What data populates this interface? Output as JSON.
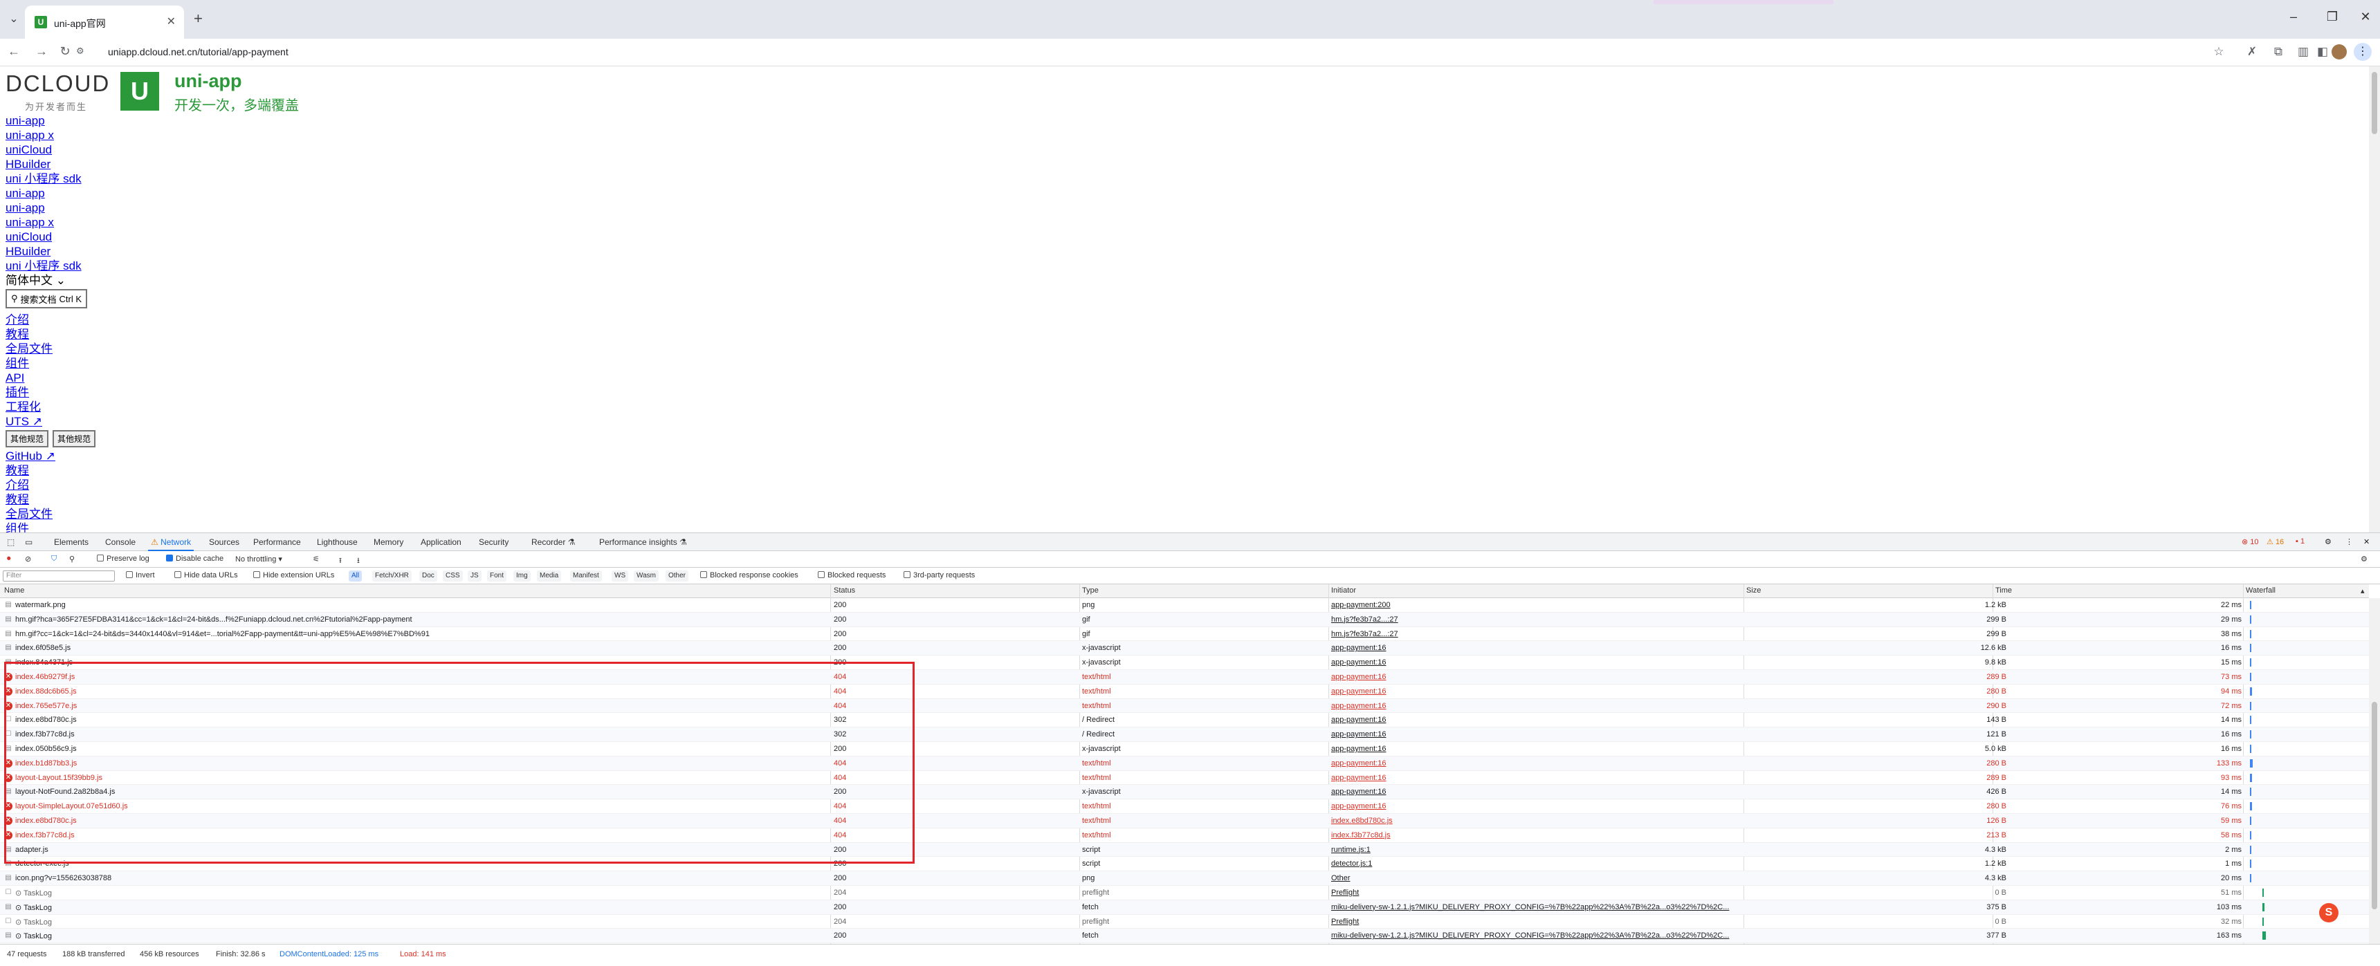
{
  "browser": {
    "tab_title": "uni-app官网",
    "tab_favicon": "U",
    "url": "uniapp.dcloud.net.cn/tutorial/app-payment",
    "window_buttons": [
      "–",
      "❐",
      "✕"
    ],
    "new_tab": "+"
  },
  "page": {
    "dcloud_logo": "DCLOUD",
    "dcloud_tagline": "为开发者而生",
    "uni_logo_letter": "U",
    "uni_name": "uni-app",
    "uni_slogan": "开发一次，多端覆盖",
    "links": [
      "uni-app",
      "uni-app x",
      "uniCloud",
      "HBuilder",
      "uni 小程序 sdk",
      "uni-app",
      "uni-app",
      "uni-app x",
      "uniCloud",
      "HBuilder",
      "uni 小程序 sdk"
    ],
    "language": "简体中文",
    "search_label": "搜索文档",
    "search_shortcut": "Ctrl K",
    "nav_links": [
      "介绍",
      "教程",
      "全局文件",
      "组件",
      "API",
      "插件",
      "工程化",
      "UTS"
    ],
    "spec_buttons": [
      "其他规范",
      "其他规范"
    ],
    "nav_links_2": [
      "GitHub",
      "教程",
      "介绍",
      "教程",
      "全局文件",
      "组件"
    ]
  },
  "devtools": {
    "tabs": [
      "Elements",
      "Console",
      "Network",
      "Sources",
      "Performance",
      "Lighthouse",
      "Memory",
      "Application",
      "Security",
      "Recorder",
      "Performance insights"
    ],
    "active_tab": "Network",
    "errors": "10",
    "warnings": "16",
    "issues": "1",
    "toolbar": {
      "preserve_log": "Preserve log",
      "disable_cache": "Disable cache",
      "throttling": "No throttling"
    },
    "filter_placeholder": "Filter",
    "filter_options": [
      "Invert",
      "Hide data URLs",
      "Hide extension URLs"
    ],
    "type_chips": [
      "All",
      "Fetch/XHR",
      "Doc",
      "CSS",
      "JS",
      "Font",
      "Img",
      "Media",
      "Manifest",
      "WS",
      "Wasm",
      "Other"
    ],
    "extra_filters": [
      "Blocked response cookies",
      "Blocked requests",
      "3rd-party requests"
    ],
    "columns": [
      "Name",
      "Status",
      "Type",
      "Initiator",
      "Size",
      "Time",
      "Waterfall"
    ],
    "rows": [
      {
        "name": "watermark.png",
        "status": "200",
        "type": "png",
        "initiator": "app-payment:200",
        "size": "1.2 kB",
        "time": "22 ms",
        "state": "ok"
      },
      {
        "name": "hm.gif?hca=365F27E5FDBA3141&cc=1&ck=1&cl=24-bit&ds...f%2Funiapp.dcloud.net.cn%2Ftutorial%2Fapp-payment",
        "status": "200",
        "type": "gif",
        "initiator": "hm.js?fe3b7a2...:27",
        "size": "299 B",
        "time": "29 ms",
        "state": "ok"
      },
      {
        "name": "hm.gif?cc=1&ck=1&cl=24-bit&ds=3440x1440&vl=914&et=...torial%2Fapp-payment&tt=uni-app%E5%AE%98%E7%BD%91",
        "status": "200",
        "type": "gif",
        "initiator": "hm.js?fe3b7a2...:27",
        "size": "299 B",
        "time": "38 ms",
        "state": "ok"
      },
      {
        "name": "index.6f058e5.js",
        "status": "200",
        "type": "x-javascript",
        "initiator": "app-payment:16",
        "size": "12.6 kB",
        "time": "16 ms",
        "state": "ok"
      },
      {
        "name": "index.84a4371.js",
        "status": "200",
        "type": "x-javascript",
        "initiator": "app-payment:16",
        "size": "9.8 kB",
        "time": "15 ms",
        "state": "ok"
      },
      {
        "name": "index.46b9279f.js",
        "status": "404",
        "type": "text/html",
        "initiator": "app-payment:16",
        "size": "289 B",
        "time": "73 ms",
        "state": "err"
      },
      {
        "name": "index.88dc6b65.js",
        "status": "404",
        "type": "text/html",
        "initiator": "app-payment:16",
        "size": "280 B",
        "time": "94 ms",
        "state": "err"
      },
      {
        "name": "index.765e577e.js",
        "status": "404",
        "type": "text/html",
        "initiator": "app-payment:16",
        "size": "290 B",
        "time": "72 ms",
        "state": "err"
      },
      {
        "name": "index.e8bd780c.js",
        "status": "302",
        "type": "/ Redirect",
        "initiator": "app-payment:16",
        "size": "143 B",
        "time": "14 ms",
        "state": "redirect"
      },
      {
        "name": "index.f3b77c8d.js",
        "status": "302",
        "type": "/ Redirect",
        "initiator": "app-payment:16",
        "size": "121 B",
        "time": "16 ms",
        "state": "redirect"
      },
      {
        "name": "index.050b56c9.js",
        "status": "200",
        "type": "x-javascript",
        "initiator": "app-payment:16",
        "size": "5.0 kB",
        "time": "16 ms",
        "state": "ok"
      },
      {
        "name": "index.b1d87bb3.js",
        "status": "404",
        "type": "text/html",
        "initiator": "app-payment:16",
        "size": "280 B",
        "time": "133 ms",
        "state": "err"
      },
      {
        "name": "layout-Layout.15f39bb9.js",
        "status": "404",
        "type": "text/html",
        "initiator": "app-payment:16",
        "size": "289 B",
        "time": "93 ms",
        "state": "err"
      },
      {
        "name": "layout-NotFound.2a82b8a4.js",
        "status": "200",
        "type": "x-javascript",
        "initiator": "app-payment:16",
        "size": "426 B",
        "time": "14 ms",
        "state": "ok"
      },
      {
        "name": "layout-SimpleLayout.07e51d60.js",
        "status": "404",
        "type": "text/html",
        "initiator": "app-payment:16",
        "size": "280 B",
        "time": "76 ms",
        "state": "err"
      },
      {
        "name": "index.e8bd780c.js",
        "status": "404",
        "type": "text/html",
        "initiator": "index.e8bd780c.js",
        "size": "126 B",
        "time": "59 ms",
        "state": "err"
      },
      {
        "name": "index.f3b77c8d.js",
        "status": "404",
        "type": "text/html",
        "initiator": "index.f3b77c8d.js",
        "size": "213 B",
        "time": "58 ms",
        "state": "err"
      },
      {
        "name": "adapter.js",
        "status": "200",
        "type": "script",
        "initiator": "runtime.js:1",
        "size": "4.3 kB",
        "time": "2 ms",
        "state": "ok"
      },
      {
        "name": "detector-exec.js",
        "status": "200",
        "type": "script",
        "initiator": "detector.js:1",
        "size": "1.2 kB",
        "time": "1 ms",
        "state": "ok"
      },
      {
        "name": "icon.png?v=1556263038788",
        "status": "200",
        "type": "png",
        "initiator": "Other",
        "size": "4.3 kB",
        "time": "20 ms",
        "state": "ok"
      },
      {
        "name": "⊙ TaskLog",
        "status": "204",
        "type": "preflight",
        "initiator": "Preflight",
        "size": "0 B",
        "time": "51 ms",
        "state": "dim"
      },
      {
        "name": "⊙ TaskLog",
        "status": "200",
        "type": "fetch",
        "initiator": "miku-delivery-sw-1.2.1.js?MIKU_DELIVERY_PROXY_CONFIG=%7B%22app%22%3A%7B%22a...o3%22%7D%2C...",
        "size": "375 B",
        "time": "103 ms",
        "state": "ok"
      },
      {
        "name": "⊙ TaskLog",
        "status": "204",
        "type": "preflight",
        "initiator": "Preflight",
        "size": "0 B",
        "time": "32 ms",
        "state": "dim"
      },
      {
        "name": "⊙ TaskLog",
        "status": "200",
        "type": "fetch",
        "initiator": "miku-delivery-sw-1.2.1.js?MIKU_DELIVERY_PROXY_CONFIG=%7B%22app%22%3A%7B%22a...o3%22%7D%2C...",
        "size": "377 B",
        "time": "163 ms",
        "state": "ok"
      }
    ],
    "footer": {
      "requests": "47 requests",
      "transferred": "188 kB transferred",
      "resources": "456 kB resources",
      "finish": "Finish: 32.86 s",
      "dcl": "DOMContentLoaded: 125 ms",
      "load": "Load: 141 ms"
    },
    "colors": {
      "error": "#d93025",
      "link": "#1a73e8",
      "highlight": "#e0262a"
    }
  }
}
